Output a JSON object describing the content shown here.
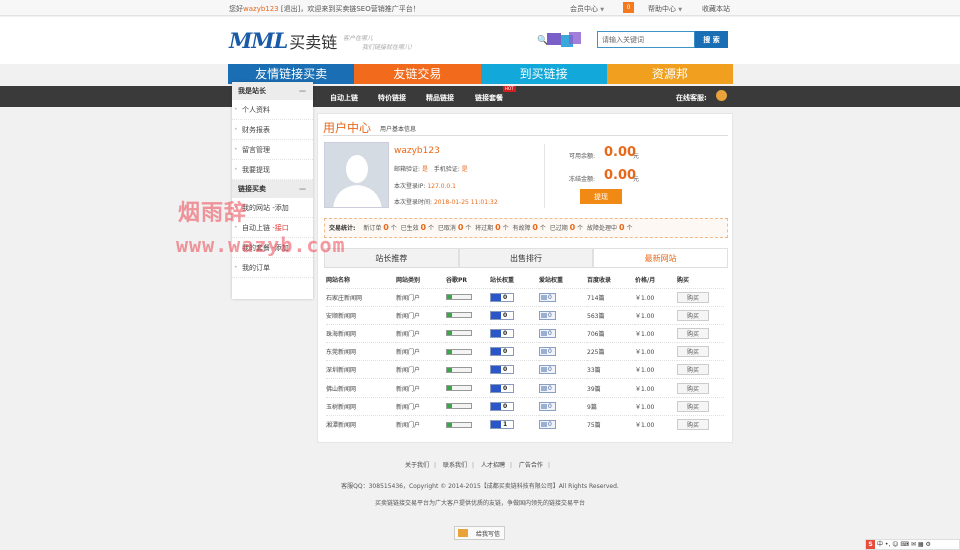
{
  "topbar": {
    "greeting_prefix": "您好",
    "username": "wazyb123",
    "greeting_rest": "[退出]，欢迎来到买卖链SEO营销推广平台！",
    "member_center": "会员中心",
    "message_count": "0",
    "help_center": "帮助中心",
    "favorite": "收藏本站"
  },
  "logo": {
    "mml": "MML",
    "name": "买卖链"
  },
  "slogan": {
    "line1": "客户在哪儿",
    "line2": "我们链接就在哪儿!"
  },
  "search": {
    "placeholder": "请输入关键词",
    "button": "搜 索"
  },
  "main_nav": [
    {
      "label": "友情链接买卖",
      "color": "#1a6eb3"
    },
    {
      "label": "友链交易",
      "color": "#f26b1d"
    },
    {
      "label": "到买链接",
      "color": "#12a8d9"
    },
    {
      "label": "资源邦",
      "color": "#f0a01e"
    }
  ],
  "sub_nav": {
    "items": [
      "自动上链",
      "特价链接",
      "精品链接",
      "链接套餐"
    ],
    "hot": "HOT",
    "online": "在线客服:"
  },
  "sidebar": {
    "group1": {
      "title": "我是站长",
      "items": [
        "个人资料",
        "财务报表",
        "留言管理",
        "我要提现"
      ]
    },
    "group2": {
      "title": "链接买卖",
      "items": [
        {
          "label": "我的网站",
          "suffix": "-添加",
          "red": false
        },
        {
          "label": "自动上链",
          "suffix": "-接口",
          "red": true
        },
        {
          "label": "我的套餐",
          "suffix": "-添加",
          "red": false
        },
        {
          "label": "我的订单",
          "suffix": "",
          "red": false
        }
      ]
    }
  },
  "watermark": {
    "line1": "烟雨辞",
    "line2": "www.wazyb.com"
  },
  "page": {
    "title": "用户中心",
    "subtitle": "用户基本信息"
  },
  "user": {
    "name": "wazyb123",
    "email_label": "邮箱验证:",
    "email_status": "是",
    "phone_label": "手机验证:",
    "phone_status": "是",
    "ip_label": "本次登录IP:",
    "ip": "127.0.0.1",
    "time_label": "本次登录时间:",
    "time": "2018-01-25 11:01:32"
  },
  "balance": {
    "available_label": "可用余额:",
    "available": "0.00",
    "frozen_label": "冻结金额:",
    "frozen": "0.00",
    "unit": "元",
    "withdraw": "提现"
  },
  "stats": {
    "label": "交易统计:",
    "items": [
      {
        "label": "新订单",
        "n": "0",
        "u": "个"
      },
      {
        "label": "已生效",
        "n": "0",
        "u": "个"
      },
      {
        "label": "已取消",
        "n": "0",
        "u": "个"
      },
      {
        "label": "将过期",
        "n": "0",
        "u": "个"
      },
      {
        "label": "有故障",
        "n": "0",
        "u": "个"
      },
      {
        "label": "已过期",
        "n": "0",
        "u": "个"
      },
      {
        "label": "故障处理中",
        "n": "0",
        "u": "个"
      }
    ]
  },
  "tabs": [
    "站长推荐",
    "出售排行",
    "最新网站"
  ],
  "table": {
    "headers": [
      "网站名称",
      "网站类别",
      "谷歌PR",
      "站长权重",
      "爱站权重",
      "百度收录",
      "价格/月",
      "购买"
    ],
    "rows": [
      {
        "name": "石家庄新闻网",
        "cat": "新闻门户",
        "pr": "0",
        "bw": "0",
        "aw": "0",
        "idx": "714篇",
        "price": "￥1.00",
        "buy": "购买"
      },
      {
        "name": "安顺新闻网",
        "cat": "新闻门户",
        "pr": "0",
        "bw": "0",
        "aw": "0",
        "idx": "563篇",
        "price": "￥1.00",
        "buy": "购买"
      },
      {
        "name": "珠海新闻网",
        "cat": "新闻门户",
        "pr": "0",
        "bw": "0",
        "aw": "0",
        "idx": "706篇",
        "price": "￥1.00",
        "buy": "购买"
      },
      {
        "name": "东莞新闻网",
        "cat": "新闻门户",
        "pr": "0",
        "bw": "0",
        "aw": "0",
        "idx": "225篇",
        "price": "￥1.00",
        "buy": "购买"
      },
      {
        "name": "深圳新闻网",
        "cat": "新闻门户",
        "pr": "0",
        "bw": "0",
        "aw": "0",
        "idx": "33篇",
        "price": "￥1.00",
        "buy": "购买"
      },
      {
        "name": "佛山新闻网",
        "cat": "新闻门户",
        "pr": "0",
        "bw": "0",
        "aw": "0",
        "idx": "39篇",
        "price": "￥1.00",
        "buy": "购买"
      },
      {
        "name": "玉树新闻网",
        "cat": "新闻门户",
        "pr": "0",
        "bw": "0",
        "aw": "0",
        "idx": "9篇",
        "price": "￥1.00",
        "buy": "购买"
      },
      {
        "name": "湘潭新闻网",
        "cat": "新闻门户",
        "pr": "0",
        "bw": "1",
        "aw": "0",
        "idx": "75篇",
        "price": "￥1.00",
        "buy": "购买"
      }
    ]
  },
  "footer": {
    "links": [
      "关于我们",
      "联系我们",
      "人才招聘",
      "广告合作"
    ],
    "copyright": "客服QQ：308515436，Copyright © 2014-2015【成都买卖链科技有限公司】All Rights Reserved.",
    "desc": "买卖链链接交易平台为广大客户提供优质的友链，争做国内领先的链接交易平台",
    "letter": "给我写信"
  },
  "ime": {
    "text": "中 •, ☺ ⌨ ✉ ▦ ⚙"
  }
}
